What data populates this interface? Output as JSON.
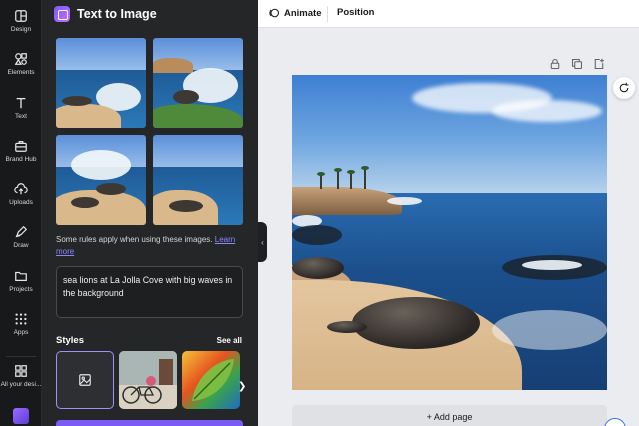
{
  "sidebar": {
    "items": [
      {
        "label": "Design",
        "icon": "layout-icon"
      },
      {
        "label": "Elements",
        "icon": "shapes-icon"
      },
      {
        "label": "Text",
        "icon": "text-icon"
      },
      {
        "label": "Brand Hub",
        "icon": "briefcase-icon"
      },
      {
        "label": "Uploads",
        "icon": "cloud-upload-icon"
      },
      {
        "label": "Draw",
        "icon": "pen-icon"
      },
      {
        "label": "Projects",
        "icon": "folder-icon"
      },
      {
        "label": "Apps",
        "icon": "grid-icon"
      },
      {
        "label": "All your desi...",
        "icon": "designs-icon"
      }
    ]
  },
  "panel": {
    "title": "Text to Image",
    "rules_text": "Some rules apply when using these images. ",
    "rules_link": "Learn more",
    "prompt": "sea lions at La Jolla Cove with big waves in the background",
    "styles_title": "Styles",
    "see_all": "See all"
  },
  "toolbar": {
    "animate": "Animate",
    "position": "Position"
  },
  "canvas": {
    "add_page": "+ Add page"
  },
  "colors": {
    "rail_bg": "#18191b",
    "panel_bg": "#252627",
    "accent": "#8b86ff",
    "canvas_bg": "#ebecf0"
  }
}
